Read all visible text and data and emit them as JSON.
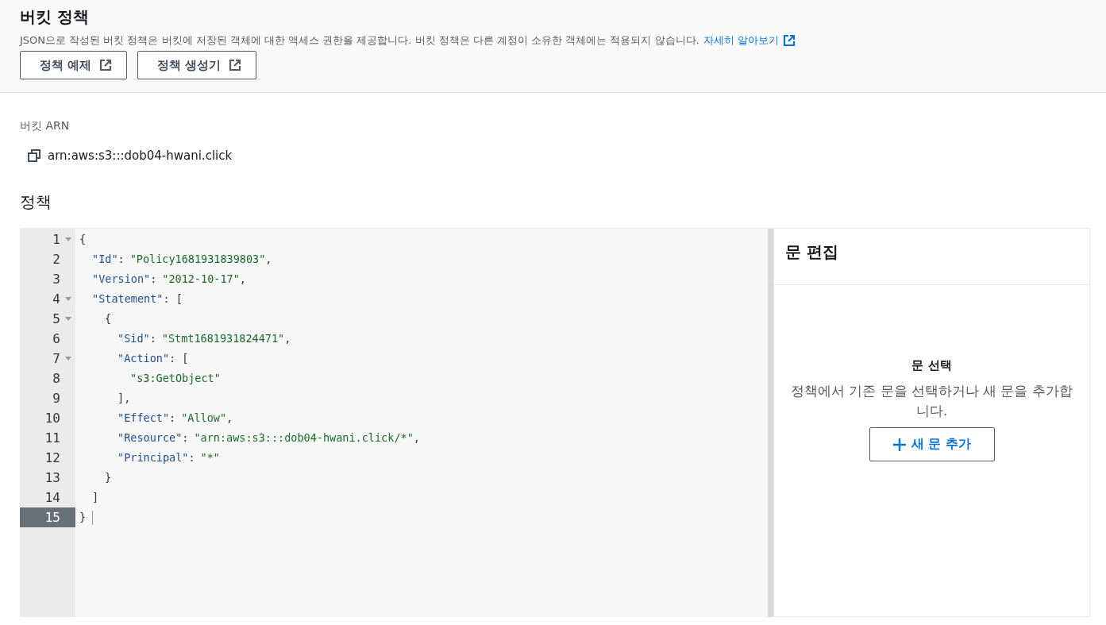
{
  "header": {
    "title": "버킷 정책",
    "description": "JSON으로 작성된 버킷 정책은 버킷에 저장된 객체에 대한 액세스 권한을 제공합니다. 버킷 정책은 다른 계정이 소유한 객체에는 적용되지 않습니다.",
    "learn_more_link": "자세히 알아보기",
    "buttons": [
      "정책 예제",
      "정책 생성기"
    ]
  },
  "bucket_arn": {
    "label": "버킷 ARN",
    "value": "arn:aws:s3:::dob04-hwani.click"
  },
  "policy": {
    "heading": "정책",
    "editor": {
      "lines": [
        {
          "number": "1",
          "active": false,
          "tokens": [
            {
              "kind": "punct",
              "text": "{"
            }
          ],
          "children": [
            {
              "number": "2",
              "active": false,
              "tokens": [
                {
                  "kind": "key",
                  "text": "\"Id\""
                },
                {
                  "kind": "punct",
                  "text": ":"
                },
                {
                  "kind": "string",
                  "text": "\"Policy1681931839803\""
                },
                {
                  "kind": "punct",
                  "text": ","
                }
              ]
            },
            {
              "number": "3",
              "active": false,
              "tokens": [
                {
                  "kind": "key",
                  "text": "\"Version\""
                },
                {
                  "kind": "punct",
                  "text": ":"
                },
                {
                  "kind": "string",
                  "text": "\"2012-10-17\""
                },
                {
                  "kind": "punct",
                  "text": ","
                }
              ]
            },
            {
              "number": "4",
              "active": false,
              "tokens": [
                {
                  "kind": "key",
                  "text": "\"Statement\""
                },
                {
                  "kind": "punct",
                  "text": ": ["
                }
              ],
              "children": [
                {
                  "number": "5",
                  "active": false,
                  "tokens": [
                    {
                      "kind": "punct",
                      "text": "{"
                    }
                  ],
                  "children": [
                    {
                      "number": "6",
                      "active": false,
                      "tokens": [
                        {
                          "kind": "key",
                          "text": "\"Sid\""
                        },
                        {
                          "kind": "punct",
                          "text": ":"
                        },
                        {
                          "kind": "string",
                          "text": "\"Stmt1681931824471\""
                        },
                        {
                          "kind": "punct",
                          "text": ","
                        }
                      ]
                    },
                    {
                      "number": "7",
                      "active": false,
                      "tokens": [
                        {
                          "kind": "key",
                          "text": "\"Action\""
                        },
                        {
                          "kind": "punct",
                          "text": ": ["
                        }
                      ],
                      "children": [
                        {
                          "number": "8",
                          "active": false,
                          "tokens": [
                            {
                              "kind": "string",
                              "text": "\"s3:GetObject\""
                            }
                          ]
                        }
                      ]
                    },
                    {
                      "number": "9",
                      "active": false,
                      "tokens": [
                        {
                          "kind": "punct",
                          "text": "],"
                        }
                      ]
                    },
                    {
                      "number": "10",
                      "active": false,
                      "tokens": [
                        {
                          "kind": "key",
                          "text": "\"Effect\""
                        },
                        {
                          "kind": "punct",
                          "text": ":"
                        },
                        {
                          "kind": "string",
                          "text": "\"Allow\""
                        },
                        {
                          "kind": "punct",
                          "text": ","
                        }
                      ]
                    },
                    {
                      "number": "11",
                      "active": false,
                      "tokens": [
                        {
                          "kind": "key",
                          "text": "\"Resource\""
                        },
                        {
                          "kind": "punct",
                          "text": ":"
                        },
                        {
                          "kind": "string",
                          "text": "\"arn:aws:s3:::dob04-hwani.click/*\""
                        },
                        {
                          "kind": "punct",
                          "text": ","
                        }
                      ]
                    },
                    {
                      "number": "12",
                      "active": false,
                      "tokens": [
                        {
                          "kind": "key",
                          "text": "\"Principal\""
                        },
                        {
                          "kind": "punct",
                          "text": ":"
                        },
                        {
                          "kind": "string",
                          "text": "\"*\""
                        }
                      ]
                    }
                  ]
                },
                {
                  "number": "13",
                  "active": false,
                  "tokens": [
                    {
                      "kind": "punct",
                      "text": "}"
                    }
                  ]
                }
              ]
            },
            {
              "number": "14",
              "active": false,
              "tokens": [
                {
                  "kind": "punct",
                  "text": "]"
                }
              ]
            }
          ]
        },
        {
          "number": "15",
          "active": true,
          "tokens": [
            {
              "kind": "punct",
              "text": "}"
            }
          ]
        }
      ]
    },
    "statement_panel": {
      "title": "문 편집",
      "empty_title": "문 선택",
      "empty_text": "정책에서 기존 문을 선택하거나 새 문을 추가합니다.",
      "add_button": "새 문 추가"
    }
  }
}
